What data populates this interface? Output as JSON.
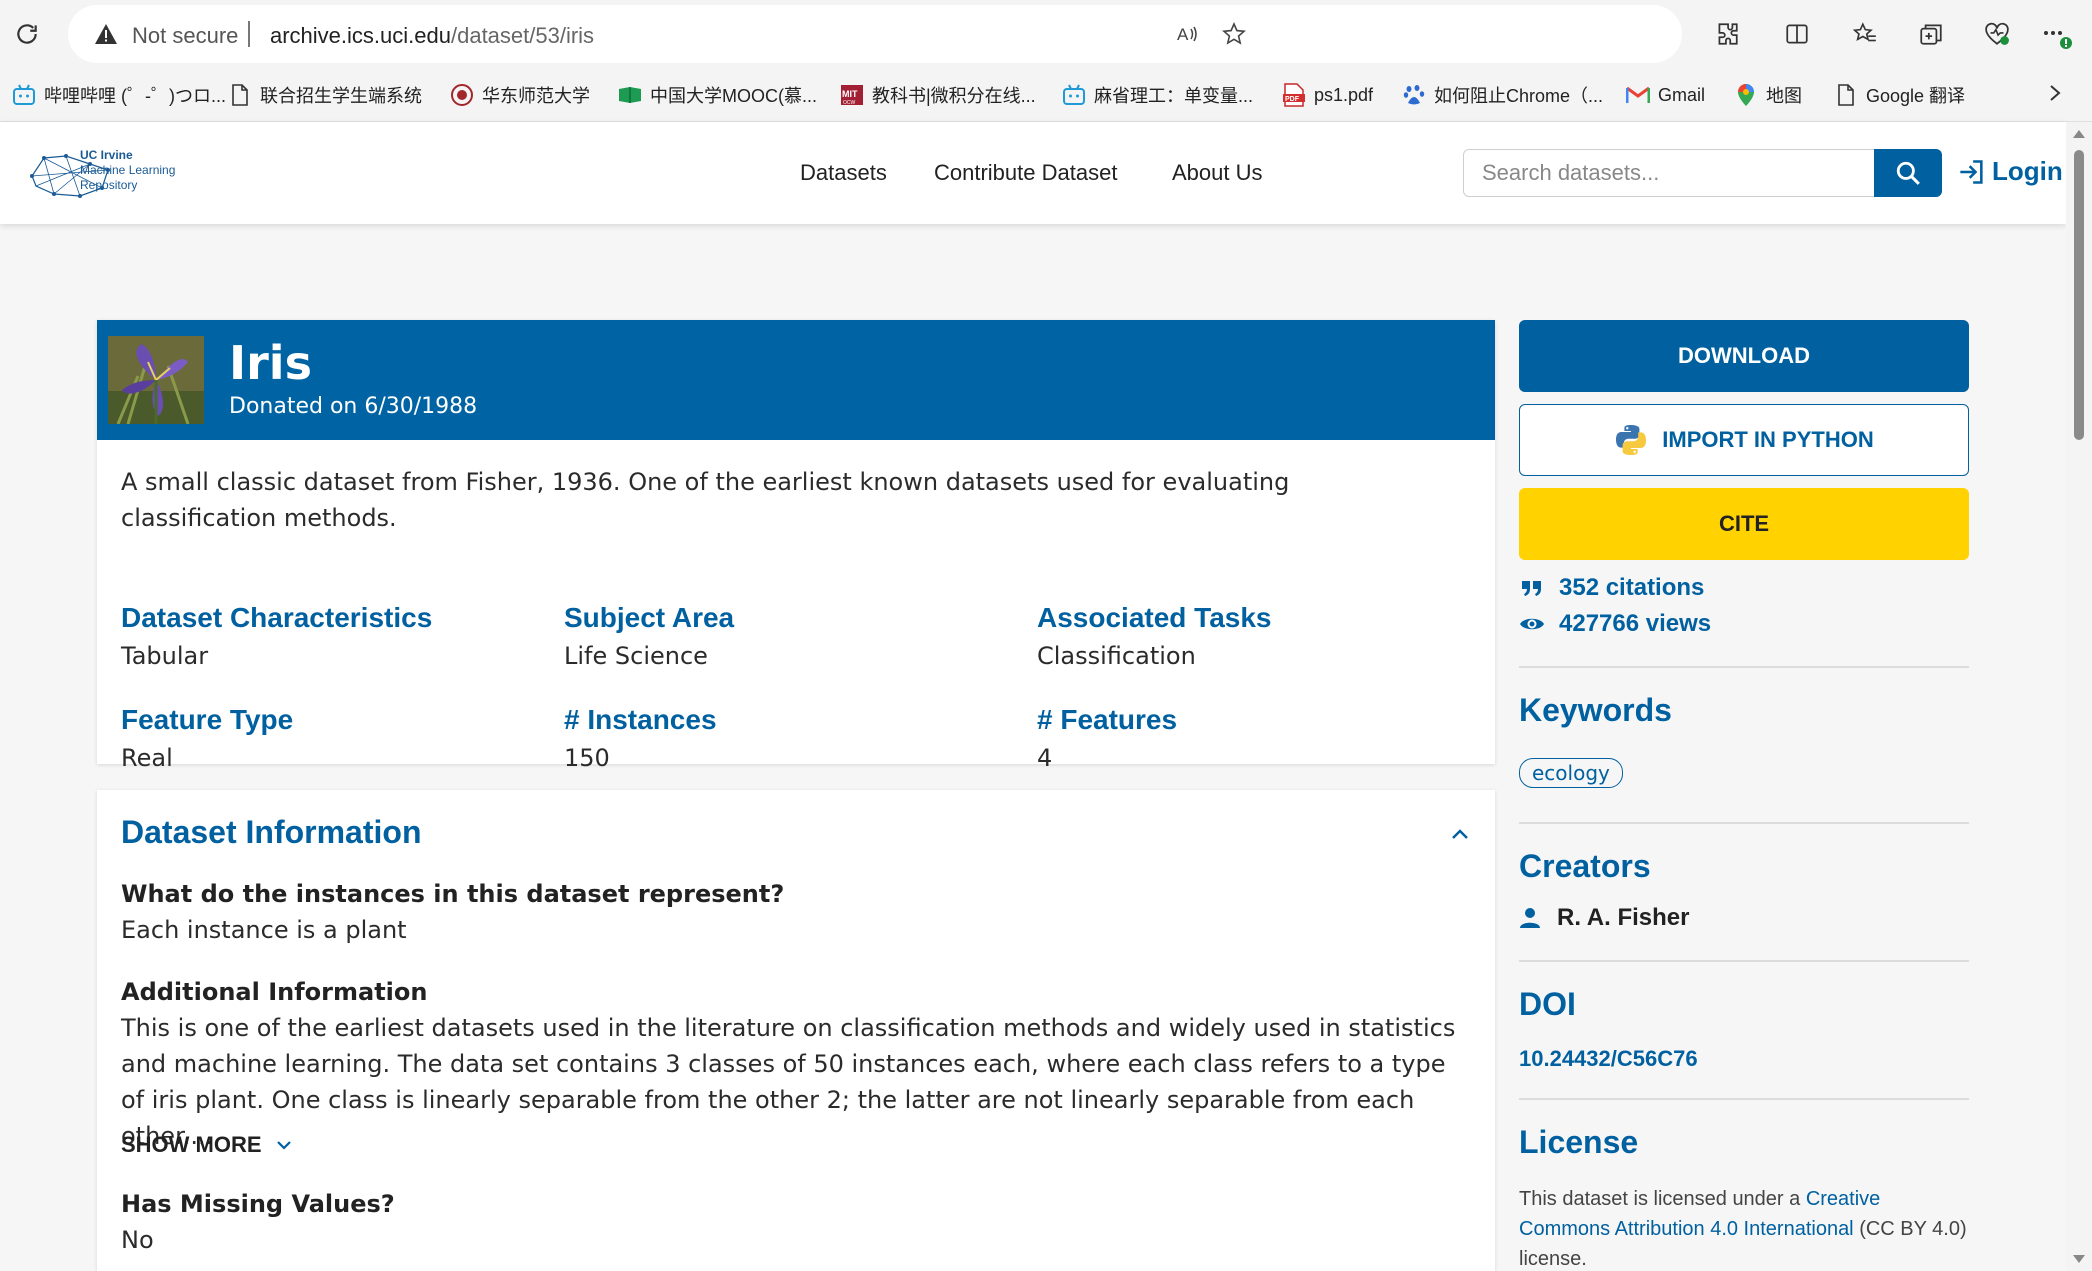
{
  "browser": {
    "security_label": "Not secure",
    "url_host": "archive.ics.uci.edu",
    "url_path": "/dataset/53/iris",
    "bookmarks": [
      {
        "label": "哔哩哔哩 (゜-゜)つロ...",
        "icon": "bilibili-icon"
      },
      {
        "label": "联合招生学生端系统",
        "icon": "page-icon"
      },
      {
        "label": "华东师范大学",
        "icon": "ecnu-icon"
      },
      {
        "label": "中国大学MOOC(慕...",
        "icon": "mooc-icon"
      },
      {
        "label": "教科书|微积分在线...",
        "icon": "mit-icon"
      },
      {
        "label": "麻省理工：单变量...",
        "icon": "bilibili-icon"
      },
      {
        "label": "ps1.pdf",
        "icon": "pdf-icon"
      },
      {
        "label": "如何阻止Chrome（...",
        "icon": "baidu-icon"
      },
      {
        "label": "Gmail",
        "icon": "gmail-icon"
      },
      {
        "label": "地图",
        "icon": "maps-icon"
      },
      {
        "label": "Google 翻译",
        "icon": "page-icon"
      }
    ]
  },
  "header": {
    "logo_line1": "UC Irvine",
    "logo_line2": "Machine Learning",
    "logo_line3": "Repository",
    "nav": [
      "Datasets",
      "Contribute Dataset",
      "About Us"
    ],
    "search_placeholder": "Search datasets...",
    "login_label": "Login"
  },
  "dataset": {
    "title": "Iris",
    "donated": "Donated on 6/30/1988",
    "description": "A small classic dataset from Fisher, 1936. One of the earliest known datasets used for evaluating classification methods.",
    "characteristics": [
      {
        "key": "Dataset Characteristics",
        "value": "Tabular"
      },
      {
        "key": "Subject Area",
        "value": "Life Science"
      },
      {
        "key": "Associated Tasks",
        "value": "Classification"
      },
      {
        "key": "Feature Type",
        "value": "Real"
      },
      {
        "key": "# Instances",
        "value": "150"
      },
      {
        "key": "# Features",
        "value": "4"
      }
    ]
  },
  "info": {
    "title": "Dataset Information",
    "q1": "What do the instances in this dataset represent?",
    "a1": "Each instance is a plant",
    "q2": "Additional Information",
    "a2": "This is one of the earliest datasets used in the literature on classification methods and widely used in statistics and machine learning.  The data set contains 3 classes of 50 instances each, where each class refers to a type of iris plant. One class is linearly separable from the other 2; the latter are not linearly separable from each other....",
    "show_more": "SHOW MORE",
    "q3": "Has Missing Values?",
    "a3": "No"
  },
  "sidebar": {
    "download": "DOWNLOAD",
    "import_python": "IMPORT IN PYTHON",
    "cite": "CITE",
    "citations": "352 citations",
    "views": "427766 views",
    "keywords_title": "Keywords",
    "keywords": [
      "ecology"
    ],
    "creators_title": "Creators",
    "creator": "R. A. Fisher",
    "doi_title": "DOI",
    "doi": "10.24432/C56C76",
    "license_title": "License",
    "license_pre": "This dataset is licensed under a ",
    "license_link": "Creative Commons Attribution 4.0 International",
    "license_post": " (CC BY 4.0) license."
  },
  "colors": {
    "brand_blue": "#0064a4",
    "cite_yellow": "#ffd200"
  }
}
